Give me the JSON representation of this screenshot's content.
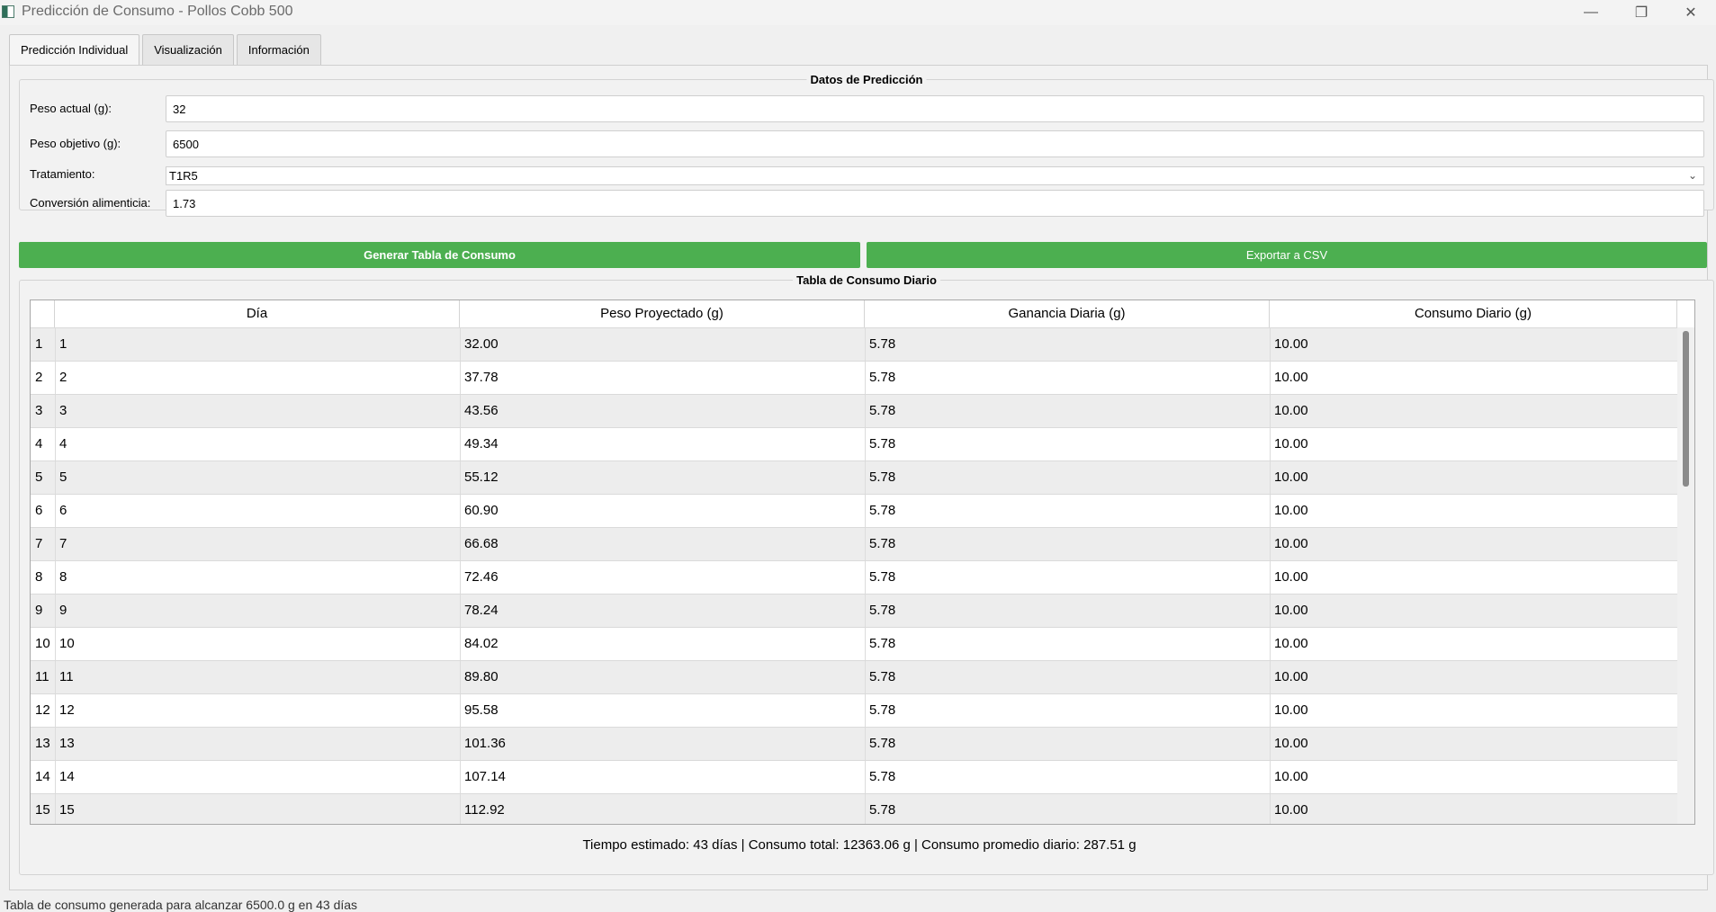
{
  "window": {
    "title": "Predicción de Consumo - Pollos Cobb 500",
    "minimize": "—",
    "restore": "❐",
    "close": "✕"
  },
  "tabs": [
    {
      "label": "Predicción Individual",
      "active": true
    },
    {
      "label": "Visualización",
      "active": false
    },
    {
      "label": "Información",
      "active": false
    }
  ],
  "form": {
    "title": "Datos de Predicción",
    "peso_actual_label": "Peso actual (g):",
    "peso_actual_value": "32",
    "peso_objetivo_label": "Peso objetivo (g):",
    "peso_objetivo_value": "6500",
    "tratamiento_label": "Tratamiento:",
    "tratamiento_value": "T1R5",
    "conversion_label": "Conversión alimenticia:",
    "conversion_value": "1.73"
  },
  "buttons": {
    "generate": "Generar Tabla de Consumo",
    "export": "Exportar a CSV"
  },
  "table": {
    "title": "Tabla de Consumo Diario",
    "headers": [
      "Día",
      "Peso Proyectado (g)",
      "Ganancia Diaria (g)",
      "Consumo Diario (g)"
    ],
    "rows": [
      {
        "n": "1",
        "dia": "1",
        "peso": "32.00",
        "ganancia": "5.78",
        "consumo": "10.00"
      },
      {
        "n": "2",
        "dia": "2",
        "peso": "37.78",
        "ganancia": "5.78",
        "consumo": "10.00"
      },
      {
        "n": "3",
        "dia": "3",
        "peso": "43.56",
        "ganancia": "5.78",
        "consumo": "10.00"
      },
      {
        "n": "4",
        "dia": "4",
        "peso": "49.34",
        "ganancia": "5.78",
        "consumo": "10.00"
      },
      {
        "n": "5",
        "dia": "5",
        "peso": "55.12",
        "ganancia": "5.78",
        "consumo": "10.00"
      },
      {
        "n": "6",
        "dia": "6",
        "peso": "60.90",
        "ganancia": "5.78",
        "consumo": "10.00"
      },
      {
        "n": "7",
        "dia": "7",
        "peso": "66.68",
        "ganancia": "5.78",
        "consumo": "10.00"
      },
      {
        "n": "8",
        "dia": "8",
        "peso": "72.46",
        "ganancia": "5.78",
        "consumo": "10.00"
      },
      {
        "n": "9",
        "dia": "9",
        "peso": "78.24",
        "ganancia": "5.78",
        "consumo": "10.00"
      },
      {
        "n": "10",
        "dia": "10",
        "peso": "84.02",
        "ganancia": "5.78",
        "consumo": "10.00"
      },
      {
        "n": "11",
        "dia": "11",
        "peso": "89.80",
        "ganancia": "5.78",
        "consumo": "10.00"
      },
      {
        "n": "12",
        "dia": "12",
        "peso": "95.58",
        "ganancia": "5.78",
        "consumo": "10.00"
      },
      {
        "n": "13",
        "dia": "13",
        "peso": "101.36",
        "ganancia": "5.78",
        "consumo": "10.00"
      },
      {
        "n": "14",
        "dia": "14",
        "peso": "107.14",
        "ganancia": "5.78",
        "consumo": "10.00"
      },
      {
        "n": "15",
        "dia": "15",
        "peso": "112.92",
        "ganancia": "5.78",
        "consumo": "10.00"
      }
    ]
  },
  "summary": "Tiempo estimado: 43 días | Consumo total: 12363.06 g | Consumo promedio diario: 287.51 g",
  "status": "Tabla de consumo generada para alcanzar 6500.0 g en 43 días",
  "colors": {
    "accent": "#4caf50",
    "alt_row": "#ededed"
  },
  "icons": [
    "app-icon",
    "chevron-down-icon",
    "minimize-icon",
    "restore-icon",
    "close-icon"
  ]
}
